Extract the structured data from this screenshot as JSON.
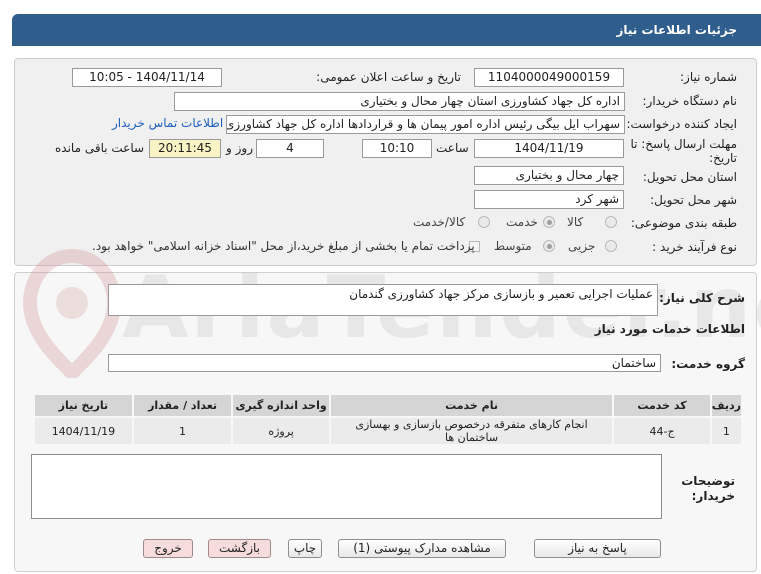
{
  "header": {
    "title": "جزئیات اطلاعات نیاز"
  },
  "fields": {
    "need_number_label": "شماره نیاز:",
    "need_number": "1104000049000159",
    "announce_label": "تاریخ و ساعت اعلان عمومی:",
    "announce_value": "1404/11/14 - 10:05",
    "buyer_org_label": "نام دستگاه خریدار:",
    "buyer_org": "اداره کل جهاد کشاورزی استان چهار محال و بختیاری",
    "creator_label": "ایجاد کننده درخواست:",
    "creator": "سهراب ایل بیگی رئیس اداره امور پیمان ها و قراردادها اداره کل جهاد کشاورزی ا",
    "contact_link": "اطلاعات تماس خریدار",
    "deadline_label_1": "مهلت ارسال پاسخ: تا",
    "deadline_label_2": "تاریخ:",
    "deadline_date": "1404/11/19",
    "hour_label": "ساعت",
    "deadline_time": "10:10",
    "days_value": "4",
    "days_label": "روز و",
    "remaining_time": "20:11:45",
    "remaining_label": "ساعت باقی مانده",
    "province_label": "استان محل تحویل:",
    "province": "چهار محال و بختیاری",
    "city_label": "شهر محل تحویل:",
    "city": "شهر کرد",
    "category_label": "طبقه بندی موضوعی:",
    "category_options": [
      "کالا",
      "خدمت",
      "کالا/خدمت"
    ],
    "process_label": "نوع فرآیند خرید :",
    "process_options": [
      "جزیی",
      "متوسط"
    ],
    "payment_note": "پرداخت تمام یا بخشی از مبلغ خرید،از محل \"اسناد خزانه اسلامی\" خواهد بود."
  },
  "description": {
    "label": "شرح کلی نیاز:",
    "value": "عملیات اجرایی تعمیر و بازسازی مرکز جهاد کشاورزی گندمان"
  },
  "services_title": "اطلاعات خدمات مورد نیاز",
  "service_group": {
    "label": "گروه خدمت:",
    "value": "ساختمان"
  },
  "table": {
    "headers": [
      "ردیف",
      "کد خدمت",
      "نام خدمت",
      "واحد اندازه گیری",
      "تعداد / مقدار",
      "تاریخ نیاز"
    ],
    "rows": [
      [
        "1",
        "ج-44",
        "انجام کارهای متفرقه درخصوص بازسازی و بهسازی ساختمان ها",
        "پروژه",
        "1",
        "1404/11/19"
      ]
    ]
  },
  "buyer_notes_label_1": "توضیحات",
  "buyer_notes_label_2": "خریدار:",
  "buttons": {
    "reply": "پاسخ به نیاز",
    "attachments": "مشاهده مدارک پیوستی (1)",
    "print": "چاپ",
    "back": "بازگشت",
    "exit": "خروج"
  },
  "watermark": "AriaTender.net"
}
